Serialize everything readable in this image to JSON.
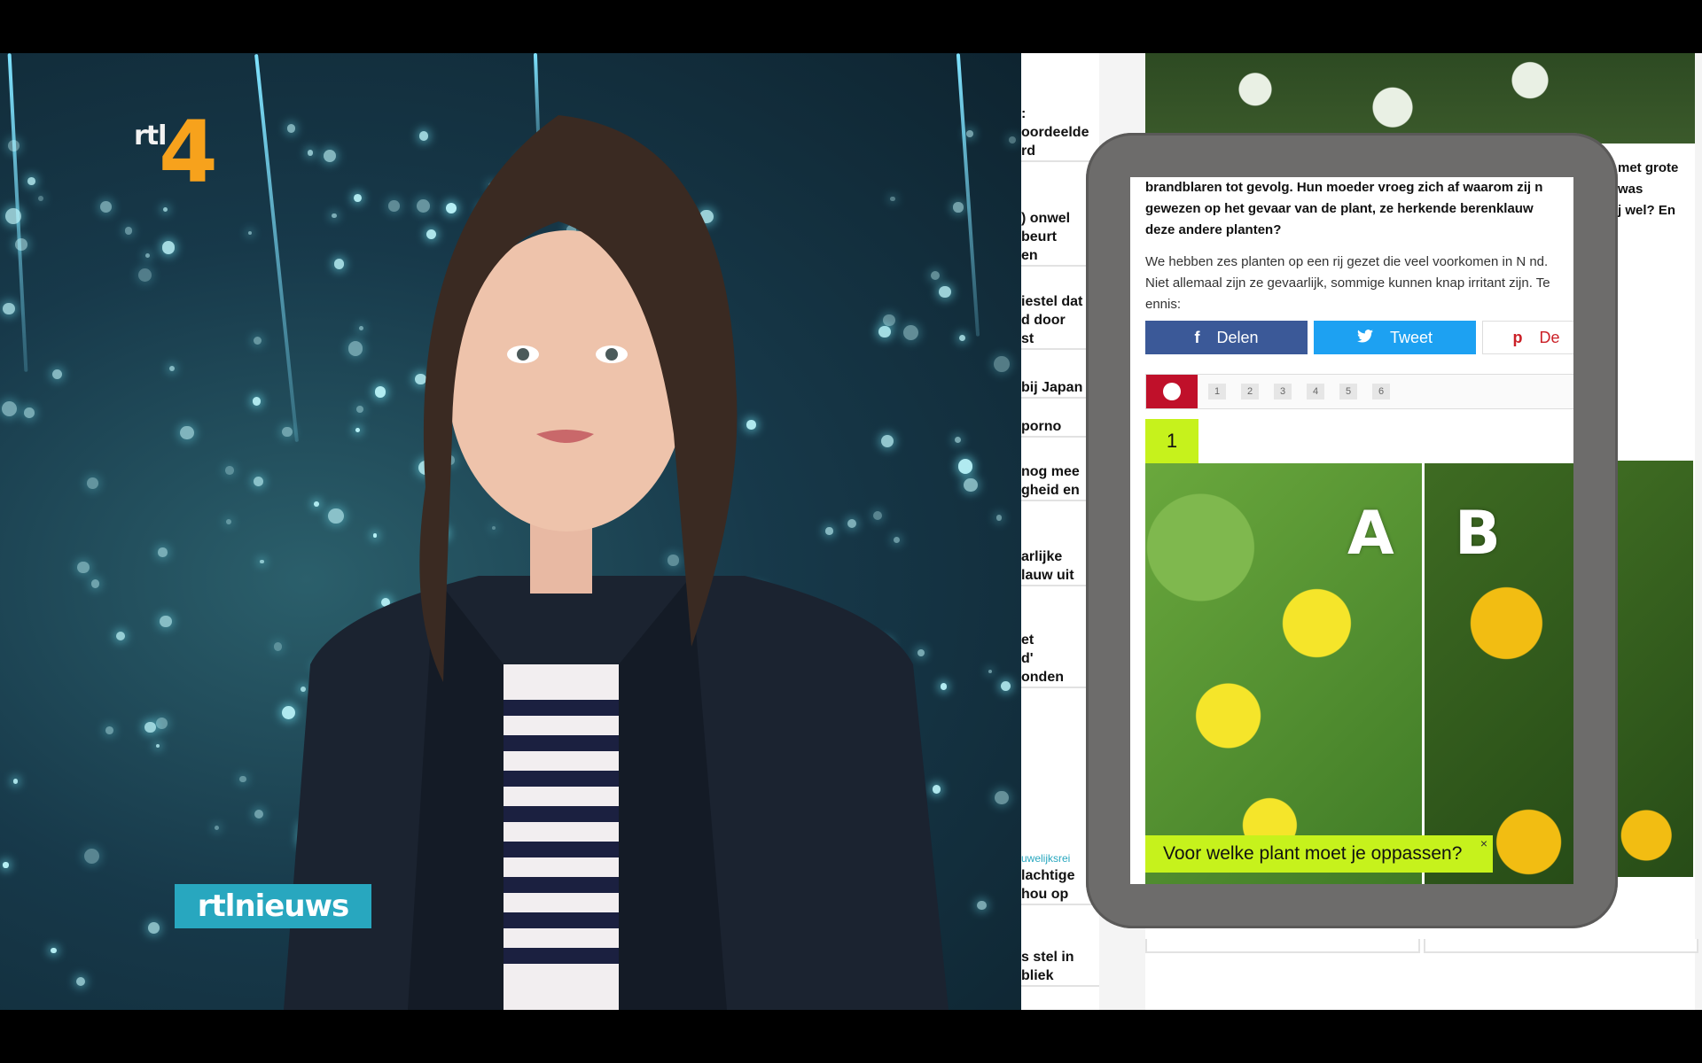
{
  "broadcast": {
    "channel_logo_text": "rtl",
    "channel_logo_number": "4",
    "program_bug": "rtlnieuws"
  },
  "sidebar": {
    "items": [
      ":\noordeelde\nrd",
      ") onwel\nbeurt\nen",
      "iestel dat\nd door\nst",
      "bij Japan",
      "porno",
      "nog mee\ngheid en",
      "arlijke\nlauw uit",
      "et\nd'\nonden",
      "uwelijksrei",
      "lachtige\nhou op",
      "s stel in\nbliek"
    ]
  },
  "right_snippet": "met grote\nwas\nj wel? En",
  "article": {
    "bold_text": "brandblaren tot gevolg. Hun moeder vroeg zich af waarom zij n gewezen op het gevaar van de plant, ze herkende berenklauw deze andere planten?",
    "paragraph": "We hebben zes planten op een rij gezet die veel voorkomen in N   nd. Niet allemaal zijn ze gevaarlijk, sommige kunnen knap irritant zijn. Te   ennis:"
  },
  "share": {
    "facebook_icon": "f",
    "facebook_label": "Delen",
    "twitter_icon": "twitter-bird",
    "twitter_label": "Tweet",
    "pinterest_icon": "p",
    "pinterest_label": "De"
  },
  "pager": {
    "pages": [
      "1",
      "2",
      "3",
      "4",
      "5",
      "6"
    ],
    "current_step": "1"
  },
  "quiz": {
    "option_a": "A",
    "option_b": "B",
    "question": "Voor welke plant moet je oppassen?",
    "close": "×"
  },
  "colors": {
    "logo_orange": "#f7a21c",
    "bug_blue": "#28a7bf",
    "quiz_green": "#c6f21c",
    "facebook": "#3b5998",
    "twitter": "#1da1f2",
    "pager_red": "#c0102a"
  }
}
